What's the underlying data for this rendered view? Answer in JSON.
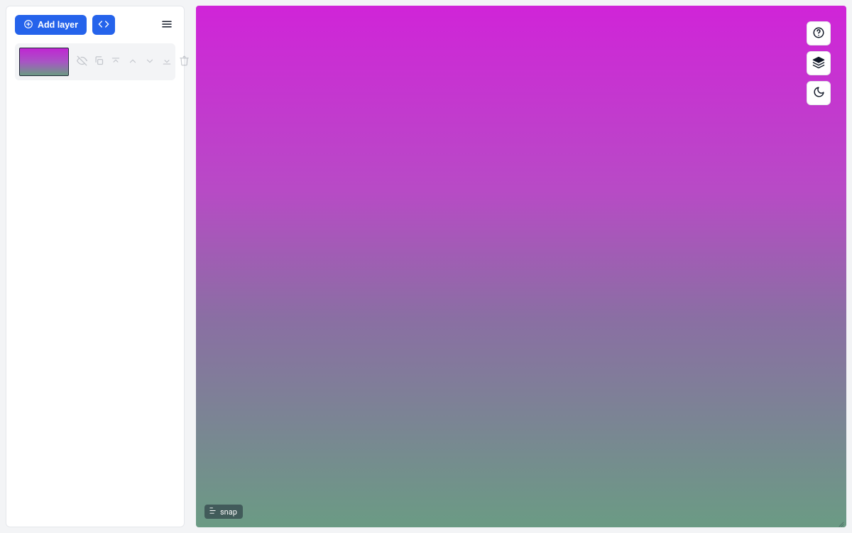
{
  "colors": {
    "primary": "#2563eb",
    "sidebar_bg": "#ffffff",
    "page_bg": "#f3f4f6",
    "gradient_from": "#d024d8",
    "gradient_to": "#6b9b84"
  },
  "sidebar": {
    "add_layer_label": "Add layer",
    "layers": [
      {
        "id": 0,
        "actions": {
          "visibility": "toggle-visibility-icon",
          "duplicate": "duplicate-icon",
          "move_top": "move-to-top-icon",
          "move_up": "move-up-icon",
          "move_down": "move-down-icon",
          "move_bottom": "move-to-bottom-icon",
          "delete": "delete-icon"
        }
      }
    ]
  },
  "canvas": {
    "snap": {
      "label": "snap"
    },
    "float_buttons": {
      "help": "help-icon",
      "layers": "layers-icon",
      "dark_mode": "dark-mode-icon"
    }
  }
}
